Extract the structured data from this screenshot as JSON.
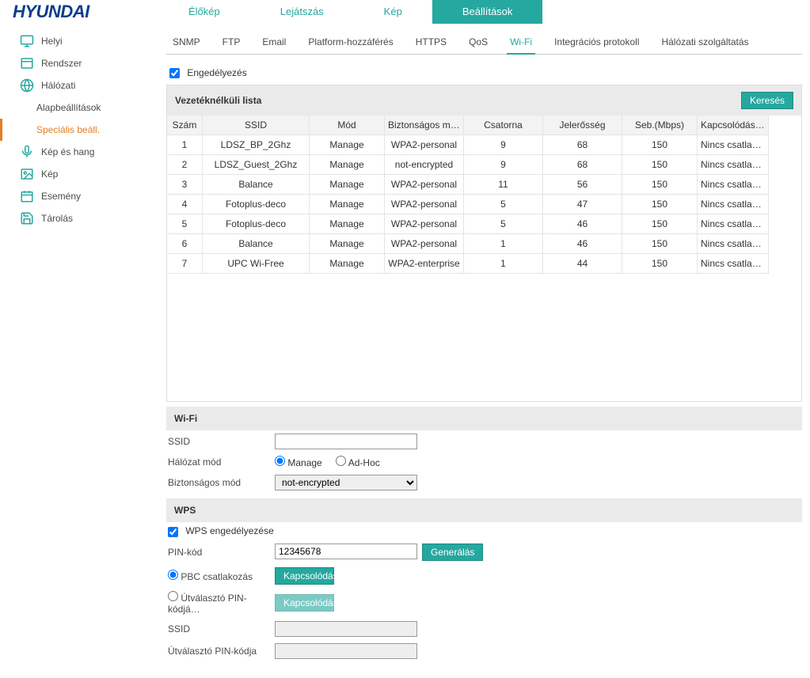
{
  "brand": "HYUNDAI",
  "topnav": [
    {
      "label": "Élőkép"
    },
    {
      "label": "Lejátszás"
    },
    {
      "label": "Kép"
    },
    {
      "label": "Beállítások",
      "active": true
    }
  ],
  "sidebar": [
    {
      "label": "Helyi",
      "icon": "monitor"
    },
    {
      "label": "Rendszer",
      "icon": "window"
    },
    {
      "label": "Hálózati",
      "icon": "globe"
    },
    {
      "label": "Alapbeállítások",
      "sub": true
    },
    {
      "label": "Speciális beáll.",
      "sub": true,
      "active": true
    },
    {
      "label": "Kép és hang",
      "icon": "mic"
    },
    {
      "label": "Kép",
      "icon": "image"
    },
    {
      "label": "Esemény",
      "icon": "calendar"
    },
    {
      "label": "Tárolás",
      "icon": "save"
    }
  ],
  "subtabs": [
    {
      "label": "SNMP"
    },
    {
      "label": "FTP"
    },
    {
      "label": "Email"
    },
    {
      "label": "Platform-hozzáférés"
    },
    {
      "label": "HTTPS"
    },
    {
      "label": "QoS"
    },
    {
      "label": "Wi-Fi",
      "active": true
    },
    {
      "label": "Integrációs protokoll"
    },
    {
      "label": "Hálózati szolgáltatás"
    }
  ],
  "enable_label": "Engedélyezés",
  "wireless": {
    "title": "Vezetéknélküli lista",
    "search_btn": "Keresés",
    "columns": [
      "Szám",
      "SSID",
      "Mód",
      "Biztonságos mód",
      "Csatorna",
      "Jelerősség",
      "Seb.(Mbps)",
      "Kapcsolódási áll…"
    ],
    "rows": [
      {
        "num": "1",
        "ssid": "LDSZ_BP_2Ghz",
        "mode": "Manage",
        "sec": "WPA2-personal",
        "ch": "9",
        "sig": "68",
        "spd": "150",
        "st": "Nincs csatlakozva"
      },
      {
        "num": "2",
        "ssid": "LDSZ_Guest_2Ghz",
        "mode": "Manage",
        "sec": "not-encrypted",
        "ch": "9",
        "sig": "68",
        "spd": "150",
        "st": "Nincs csatlakozva"
      },
      {
        "num": "3",
        "ssid": "Balance",
        "mode": "Manage",
        "sec": "WPA2-personal",
        "ch": "11",
        "sig": "56",
        "spd": "150",
        "st": "Nincs csatlakozva"
      },
      {
        "num": "4",
        "ssid": "Fotoplus-deco",
        "mode": "Manage",
        "sec": "WPA2-personal",
        "ch": "5",
        "sig": "47",
        "spd": "150",
        "st": "Nincs csatlakozva"
      },
      {
        "num": "5",
        "ssid": "Fotoplus-deco",
        "mode": "Manage",
        "sec": "WPA2-personal",
        "ch": "5",
        "sig": "46",
        "spd": "150",
        "st": "Nincs csatlakozva"
      },
      {
        "num": "6",
        "ssid": "Balance",
        "mode": "Manage",
        "sec": "WPA2-personal",
        "ch": "1",
        "sig": "46",
        "spd": "150",
        "st": "Nincs csatlakozva"
      },
      {
        "num": "7",
        "ssid": "UPC Wi-Free",
        "mode": "Manage",
        "sec": "WPA2-enterprise",
        "ch": "1",
        "sig": "44",
        "spd": "150",
        "st": "Nincs csatlakozva"
      }
    ]
  },
  "wifi": {
    "title": "Wi-Fi",
    "ssid_label": "SSID",
    "ssid_value": "",
    "mode_label": "Hálózat mód",
    "mode_manage": "Manage",
    "mode_adhoc": "Ad-Hoc",
    "sec_label": "Biztonságos mód",
    "sec_value": "not-encrypted"
  },
  "wps": {
    "title": "WPS",
    "enable_label": "WPS engedélyezése",
    "pin_label": "PIN-kód",
    "pin_value": "12345678",
    "generate_btn": "Generálás",
    "pbc_label": "PBC csatlakozás",
    "connect_btn": "Kapcsolódás",
    "router_pin_opt": "Útválasztó PIN-kódjá…",
    "ssid_label": "SSID",
    "ssid_value": "",
    "router_pin_label": "Útválasztó PIN-kódja",
    "router_pin_value": ""
  }
}
